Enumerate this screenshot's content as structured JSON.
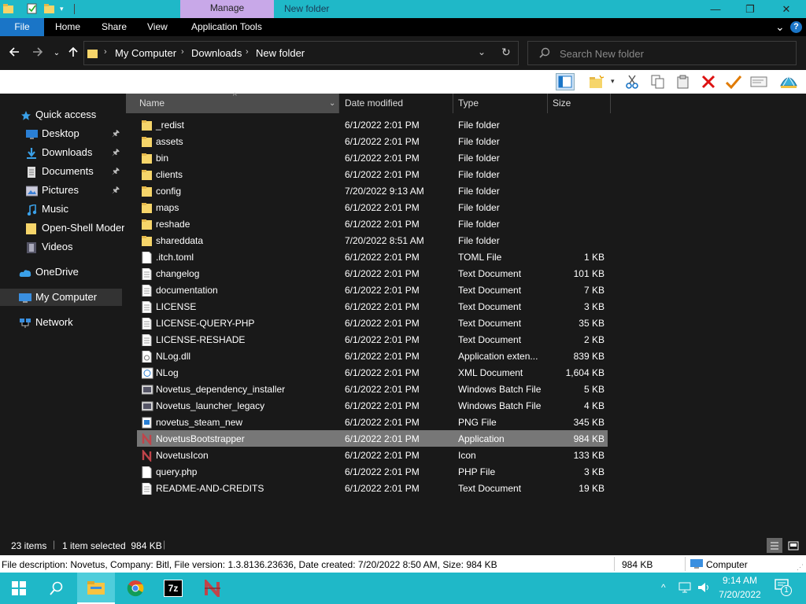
{
  "titlebar": {
    "manage_label": "Manage",
    "title": "New folder",
    "minimize": "—",
    "maximize": "❐",
    "close": "✕"
  },
  "ribbon": {
    "tabs": [
      "File",
      "Home",
      "Share",
      "View",
      "Application Tools"
    ],
    "expand": "⌄",
    "help": "?"
  },
  "address": {
    "crumbs": [
      "My Computer",
      "Downloads",
      "New folder"
    ],
    "separator": "›",
    "search_placeholder": "Search New folder"
  },
  "nav": {
    "items": [
      {
        "label": "Quick access",
        "icon": "star-icon",
        "pinned": false
      },
      {
        "label": "Desktop",
        "icon": "desktop-icon",
        "pinned": true
      },
      {
        "label": "Downloads",
        "icon": "download-icon",
        "pinned": true
      },
      {
        "label": "Documents",
        "icon": "documents-icon",
        "pinned": true
      },
      {
        "label": "Pictures",
        "icon": "pictures-icon",
        "pinned": true
      },
      {
        "label": "Music",
        "icon": "music-icon",
        "pinned": false
      },
      {
        "label": "Open-Shell Modern",
        "icon": "folder-icon",
        "pinned": false
      },
      {
        "label": "Videos",
        "icon": "videos-icon",
        "pinned": false
      },
      {
        "label": "OneDrive",
        "icon": "cloud-icon",
        "pinned": false
      },
      {
        "label": "My Computer",
        "icon": "computer-icon",
        "pinned": false
      },
      {
        "label": "Network",
        "icon": "network-icon",
        "pinned": false
      }
    ],
    "pin_glyph": "📌"
  },
  "columns": {
    "name": "Name",
    "date": "Date modified",
    "type": "Type",
    "size": "Size"
  },
  "files": [
    {
      "name": "_redist",
      "date": "6/1/2022 2:01 PM",
      "type": "File folder",
      "size": "",
      "icon": "folder"
    },
    {
      "name": "assets",
      "date": "6/1/2022 2:01 PM",
      "type": "File folder",
      "size": "",
      "icon": "folder"
    },
    {
      "name": "bin",
      "date": "6/1/2022 2:01 PM",
      "type": "File folder",
      "size": "",
      "icon": "folder"
    },
    {
      "name": "clients",
      "date": "6/1/2022 2:01 PM",
      "type": "File folder",
      "size": "",
      "icon": "folder"
    },
    {
      "name": "config",
      "date": "7/20/2022 9:13 AM",
      "type": "File folder",
      "size": "",
      "icon": "folder"
    },
    {
      "name": "maps",
      "date": "6/1/2022 2:01 PM",
      "type": "File folder",
      "size": "",
      "icon": "folder"
    },
    {
      "name": "reshade",
      "date": "6/1/2022 2:01 PM",
      "type": "File folder",
      "size": "",
      "icon": "folder"
    },
    {
      "name": "shareddata",
      "date": "7/20/2022 8:51 AM",
      "type": "File folder",
      "size": "",
      "icon": "folder"
    },
    {
      "name": ".itch.toml",
      "date": "6/1/2022 2:01 PM",
      "type": "TOML File",
      "size": "1 KB",
      "icon": "file"
    },
    {
      "name": "changelog",
      "date": "6/1/2022 2:01 PM",
      "type": "Text Document",
      "size": "101 KB",
      "icon": "text"
    },
    {
      "name": "documentation",
      "date": "6/1/2022 2:01 PM",
      "type": "Text Document",
      "size": "7 KB",
      "icon": "text"
    },
    {
      "name": "LICENSE",
      "date": "6/1/2022 2:01 PM",
      "type": "Text Document",
      "size": "3 KB",
      "icon": "text"
    },
    {
      "name": "LICENSE-QUERY-PHP",
      "date": "6/1/2022 2:01 PM",
      "type": "Text Document",
      "size": "35 KB",
      "icon": "text"
    },
    {
      "name": "LICENSE-RESHADE",
      "date": "6/1/2022 2:01 PM",
      "type": "Text Document",
      "size": "2 KB",
      "icon": "text"
    },
    {
      "name": "NLog.dll",
      "date": "6/1/2022 2:01 PM",
      "type": "Application exten...",
      "size": "839 KB",
      "icon": "dll"
    },
    {
      "name": "NLog",
      "date": "6/1/2022 2:01 PM",
      "type": "XML Document",
      "size": "1,604 KB",
      "icon": "xml"
    },
    {
      "name": "Novetus_dependency_installer",
      "date": "6/1/2022 2:01 PM",
      "type": "Windows Batch File",
      "size": "5 KB",
      "icon": "bat"
    },
    {
      "name": "Novetus_launcher_legacy",
      "date": "6/1/2022 2:01 PM",
      "type": "Windows Batch File",
      "size": "4 KB",
      "icon": "bat"
    },
    {
      "name": "novetus_steam_new",
      "date": "6/1/2022 2:01 PM",
      "type": "PNG File",
      "size": "345 KB",
      "icon": "png"
    },
    {
      "name": "NovetusBootstrapper",
      "date": "6/1/2022 2:01 PM",
      "type": "Application",
      "size": "984 KB",
      "icon": "app",
      "selected": true
    },
    {
      "name": "NovetusIcon",
      "date": "6/1/2022 2:01 PM",
      "type": "Icon",
      "size": "133 KB",
      "icon": "ico"
    },
    {
      "name": "query.php",
      "date": "6/1/2022 2:01 PM",
      "type": "PHP File",
      "size": "3 KB",
      "icon": "file"
    },
    {
      "name": "README-AND-CREDITS",
      "date": "6/1/2022 2:01 PM",
      "type": "Text Document",
      "size": "19 KB",
      "icon": "text"
    }
  ],
  "status": {
    "count": "23 items",
    "selection": "1 item selected  984 KB"
  },
  "details": {
    "description": "File description: Novetus, Company: Bitl, File version: 1.3.8136.23636, Date created: 7/20/2022 8:50 AM, Size: 984 KB",
    "size": "984 KB",
    "location": "Computer"
  },
  "taskbar": {
    "time": "9:14 AM",
    "date": "7/20/2022",
    "notification_count": "1"
  },
  "colors": {
    "titlebar": "#1fb8c8",
    "manage_tab": "#c8a8e8",
    "file_tab": "#1a75c7",
    "selection": "#777777",
    "folder": "#f6d56a"
  }
}
